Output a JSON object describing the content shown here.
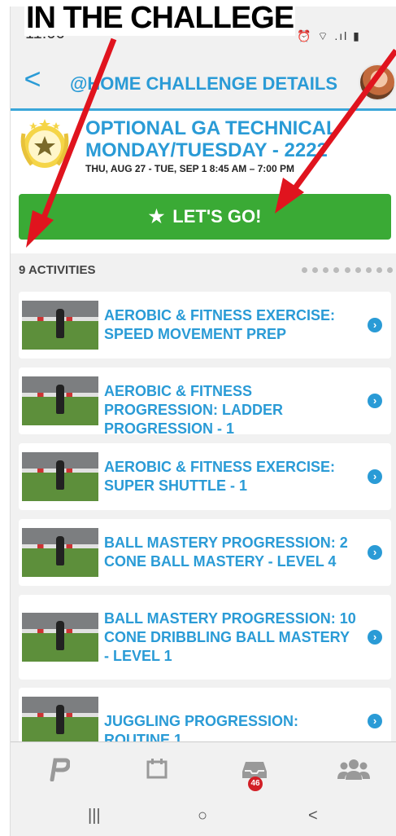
{
  "annotation": {
    "caption": "IN THE CHALLEGE"
  },
  "status": {
    "time": "11:06",
    "icons": "⏰ ⌔ .ıl ▮"
  },
  "header": {
    "back_label": "<",
    "title": "@HOME CHALLENGE DETAILS"
  },
  "challenge": {
    "title": "OPTIONAL GA TECHNICAL MONDAY/TUESDAY - 2222",
    "dates": "THU, AUG 27 - TUE, SEP 1 8:45 AM – 7:00 PM",
    "go_label": "LET'S GO!"
  },
  "activities": {
    "count_label": "9 ACTIVITIES",
    "pages": 9,
    "items": [
      {
        "title": "AEROBIC & FITNESS EXERCISE: SPEED MOVEMENT PREP"
      },
      {
        "title": "AEROBIC & FITNESS PROGRESSION: LADDER PROGRESSION - 1"
      },
      {
        "title": "AEROBIC & FITNESS EXERCISE: SUPER SHUTTLE - 1"
      },
      {
        "title": "BALL MASTERY PROGRESSION: 2 CONE BALL MASTERY - LEVEL 4"
      },
      {
        "title": "BALL MASTERY PROGRESSION: 10 CONE DRIBBLING BALL MASTERY - LEVEL 1"
      },
      {
        "title": "JUGGLING PROGRESSION: ROUTINE 1"
      }
    ]
  },
  "tabs": {
    "items": [
      {
        "icon": "logo-icon"
      },
      {
        "icon": "calendar-icon"
      },
      {
        "icon": "inbox-icon",
        "badge": "46"
      },
      {
        "icon": "team-icon"
      }
    ]
  },
  "nav": {
    "recent": "|||",
    "home": "○",
    "back": "<"
  },
  "colors": {
    "accent": "#2a9bd6",
    "go": "#3aaa35",
    "arrow": "#e0141e",
    "badge": "#d21f26"
  }
}
